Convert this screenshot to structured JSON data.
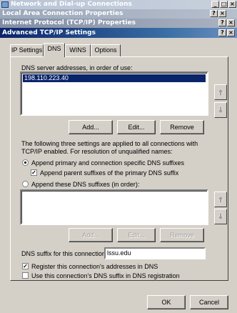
{
  "windows": {
    "network_title": "Network and Dial-up Connections",
    "lan_title": "Local Area Connection Properties",
    "tcpip_title": "Internet Protocol (TCP/IP) Properties",
    "advanced_title": "Advanced TCP/IP Settings",
    "help_glyph": "?",
    "close_glyph": "×",
    "minimize_glyph": "_",
    "maximize_glyph": "□"
  },
  "tabs": [
    {
      "label": "IP Settings",
      "active": false
    },
    {
      "label": "DNS",
      "active": true
    },
    {
      "label": "WINS",
      "active": false
    },
    {
      "label": "Options",
      "active": false
    }
  ],
  "dns": {
    "servers_label": "DNS server addresses, in order of use:",
    "servers": [
      "198.110.223.40"
    ],
    "add_label": "Add...",
    "edit_label": "Edit...",
    "remove_label": "Remove",
    "description": "The following three settings are applied to all connections with TCP/IP enabled. For resolution of unqualified names:",
    "radio_primary_label": "Append primary and connection specific DNS suffixes",
    "radio_primary_selected": true,
    "check_parent_label": "Append parent suffixes of the primary DNS suffix",
    "check_parent_checked": true,
    "radio_these_label": "Append these DNS suffixes (in order):",
    "radio_these_selected": false,
    "suffix_add_label": "Add...",
    "suffix_edit_label": "Edit...",
    "suffix_remove_label": "Remove",
    "connection_suffix_label": "DNS suffix for this connection:",
    "connection_suffix_value": "lssu.edu",
    "register_label": "Register this connection's addresses in DNS",
    "register_checked": true,
    "use_suffix_label": "Use this connection's DNS suffix in DNS registration",
    "use_suffix_checked": false
  },
  "footer": {
    "ok_label": "OK",
    "cancel_label": "Cancel"
  },
  "icons": {
    "up_arrow": "up-arrow-icon",
    "down_arrow": "down-arrow-icon",
    "network": "network-connections-icon"
  }
}
